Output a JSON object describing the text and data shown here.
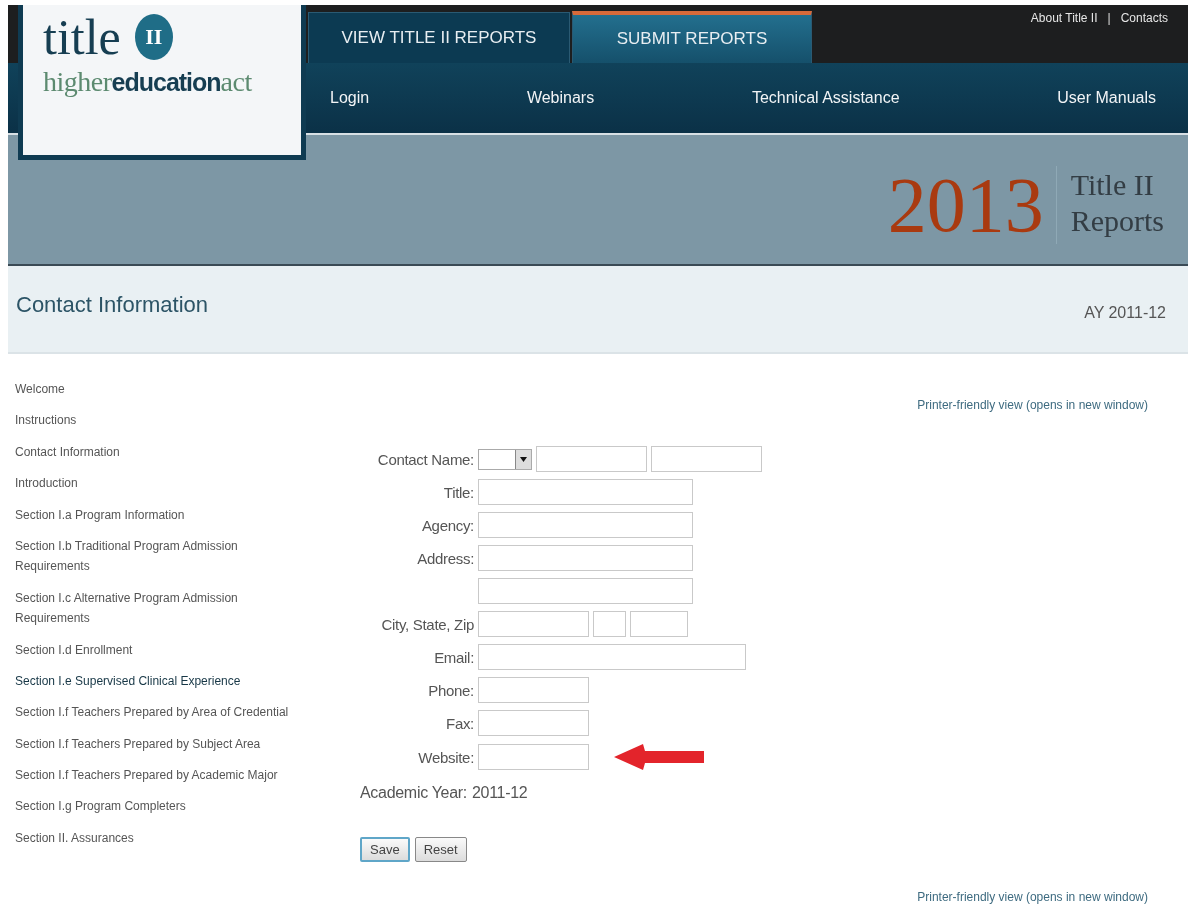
{
  "logo": {
    "title": "title",
    "badge": "II",
    "tagline": "higher**education**act"
  },
  "top_links": {
    "items": [
      "About Title II",
      "Contacts"
    ],
    "separator": "|"
  },
  "tabs": [
    {
      "label": "VIEW TITLE II REPORTS",
      "selected": false
    },
    {
      "label": "SUBMIT REPORTS",
      "selected": true
    }
  ],
  "nav": [
    "Login",
    "Webinars",
    "Technical Assistance",
    "User Manuals"
  ],
  "banner": {
    "year": "2013",
    "title_line1": "Title II",
    "title_line2": "Reports"
  },
  "page_title": "Contact Information",
  "academic_year_badge": "AY 2011-12",
  "sidebar": {
    "items": [
      {
        "label": "Welcome",
        "selected": false
      },
      {
        "label": "Instructions",
        "selected": false
      },
      {
        "label": "Contact Information",
        "selected": false
      },
      {
        "label": "Introduction",
        "selected": false
      },
      {
        "label": "Section I.a Program Information",
        "selected": false
      },
      {
        "label": "Section I.b Traditional Program Admission Requirements",
        "selected": false
      },
      {
        "label": "Section I.c Alternative Program Admission Requirements",
        "selected": false
      },
      {
        "label": "Section I.d Enrollment",
        "selected": false
      },
      {
        "label": "Section I.e Supervised Clinical Experience",
        "selected": true
      },
      {
        "label": "Section I.f Teachers Prepared by Area of Credential",
        "selected": false
      },
      {
        "label": "Section I.f Teachers Prepared by Subject Area",
        "selected": false
      },
      {
        "label": "Section I.f Teachers Prepared by Academic Major",
        "selected": false
      },
      {
        "label": "Section I.g Program Completers",
        "selected": false
      },
      {
        "label": "Section II. Assurances",
        "selected": false
      }
    ]
  },
  "printer_link_top": "Printer-friendly view (opens in new window)",
  "form": {
    "fields": [
      {
        "label": "Contact Name:",
        "kind": "name"
      },
      {
        "label": "Title:",
        "kind": "long"
      },
      {
        "label": "Agency:",
        "kind": "long"
      },
      {
        "label": "Address:",
        "kind": "long"
      },
      {
        "kind": "long"
      },
      {
        "label": "City, State, Zip",
        "kind": "city"
      },
      {
        "label": "Email:",
        "kind": "email"
      },
      {
        "label": "Phone:",
        "kind": "short"
      },
      {
        "label": "Fax:",
        "kind": "short"
      },
      {
        "label": "Website:",
        "kind": "short",
        "arrow": true
      }
    ],
    "academic_year_label": "Academic Year:",
    "academic_year_value": "2011-12",
    "buttons": [
      {
        "label": "Save",
        "focused": true
      },
      {
        "label": "Reset",
        "focused": false
      }
    ]
  },
  "printer_link_bottom": "Printer-friendly view (opens in new window)"
}
